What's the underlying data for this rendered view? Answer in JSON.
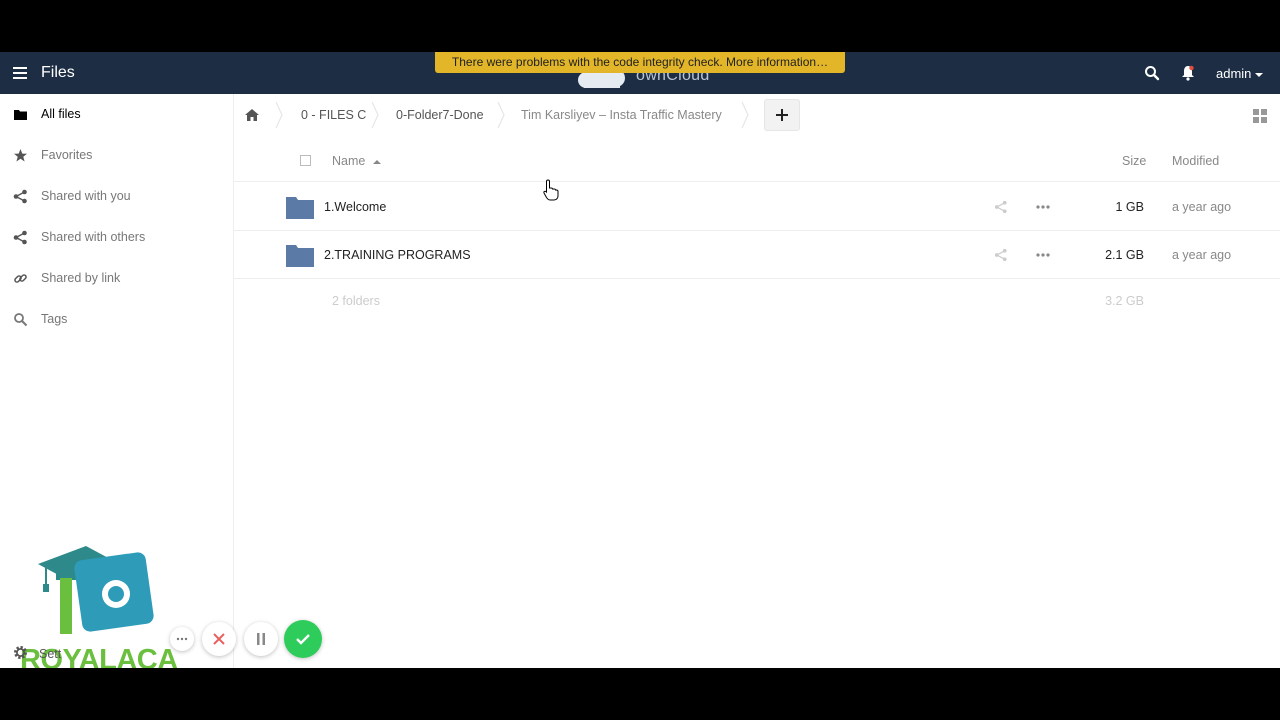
{
  "header": {
    "app_title": "Files",
    "brand_name": "ownCloud",
    "integrity_warning": "There were problems with the code integrity check. More information…",
    "user": "admin"
  },
  "sidebar": {
    "items": [
      {
        "label": "All files",
        "icon": "folder-icon",
        "active": true
      },
      {
        "label": "Favorites",
        "icon": "star-icon",
        "active": false
      },
      {
        "label": "Shared with you",
        "icon": "share-icon",
        "active": false
      },
      {
        "label": "Shared with others",
        "icon": "share-icon",
        "active": false
      },
      {
        "label": "Shared by link",
        "icon": "link-icon",
        "active": false
      },
      {
        "label": "Tags",
        "icon": "tag-search-icon",
        "active": false
      }
    ],
    "settings_label": "Sett",
    "watermark_text": "ROYALACA"
  },
  "breadcrumb": {
    "items": [
      "0 - FILES C",
      "0-Folder7-Done",
      "Tim Karsliyev – Insta Traffic Mastery"
    ]
  },
  "table": {
    "columns": {
      "name": "Name",
      "size": "Size",
      "modified": "Modified"
    },
    "rows": [
      {
        "name": "1.Welcome",
        "size": "1 GB",
        "modified": "a year ago"
      },
      {
        "name": "2.TRAINING PROGRAMS",
        "size": "2.1 GB",
        "modified": "a year ago"
      }
    ],
    "summary": {
      "count": "2 folders",
      "total": "3.2 GB"
    }
  },
  "colors": {
    "header_bg": "#1d2d44",
    "warning_bg": "#e2b628",
    "folder": "#5b7aa5",
    "ok_green": "#2ecc5b",
    "cancel_red": "#e86060"
  }
}
